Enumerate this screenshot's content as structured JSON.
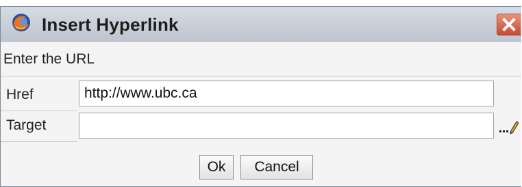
{
  "window": {
    "title": "Insert Hyperlink",
    "close_icon": "close-icon",
    "app_icon": "firefox-icon"
  },
  "form": {
    "heading": "Enter the URL",
    "href_label": "Href",
    "href_value": "http://www.ubc.ca",
    "target_label": "Target",
    "target_value": "",
    "target_picker_icon": "ellipsis-pencil-icon"
  },
  "buttons": {
    "ok": "Ok",
    "cancel": "Cancel"
  },
  "colors": {
    "titlebar": "#c9cfd9",
    "close_button": "#c8492f",
    "dialog_background": "#f4f4f4"
  }
}
